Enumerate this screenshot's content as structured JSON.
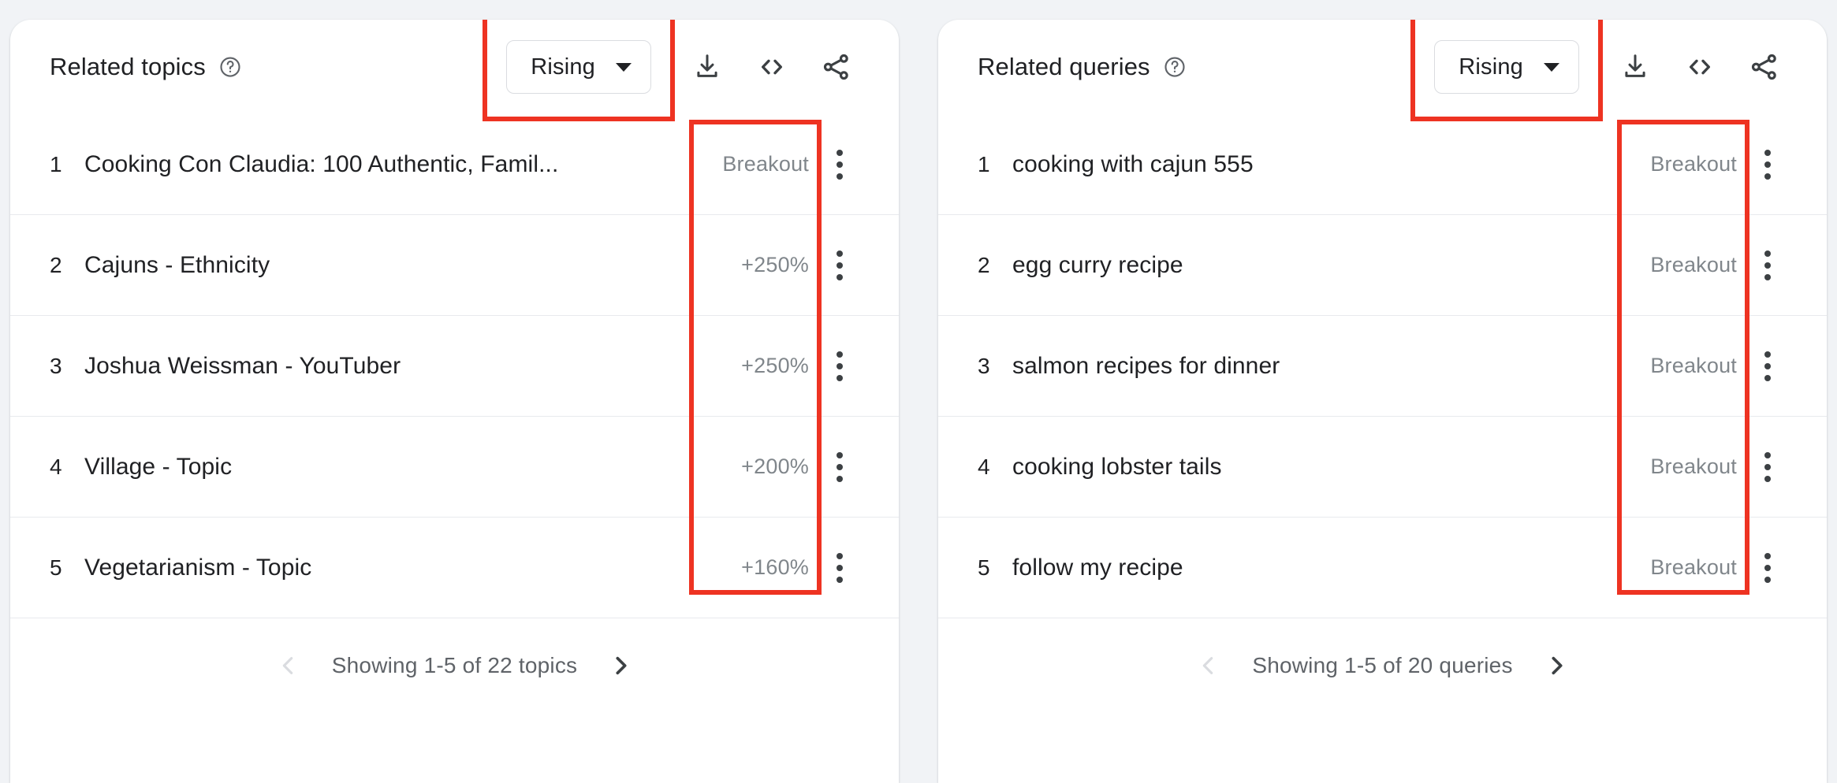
{
  "colors": {
    "page_background": "#f1f3f6",
    "card_background": "#ffffff",
    "highlight_red": "#ee3322",
    "primary_text": "#202124",
    "muted_text": "#5f6368",
    "value_text": "#80868b",
    "divider": "#e8eaed",
    "arrow_disabled": "#dadce0"
  },
  "panels": [
    {
      "title": "Related topics",
      "help_icon": "help-circle-icon",
      "sort_select": {
        "value": "Rising",
        "caret_icon": "chevron-down-icon",
        "highlighted": true
      },
      "actions": [
        {
          "icon": "download-icon",
          "label": "Download"
        },
        {
          "icon": "embed-code-icon",
          "label": "Embed"
        },
        {
          "icon": "share-icon",
          "label": "Share"
        }
      ],
      "value_column_highlighted": true,
      "rows": [
        {
          "rank": "1",
          "label": "Cooking Con Claudia: 100 Authentic, Famil...",
          "value": "Breakout",
          "menu_icon": "more-vert-icon"
        },
        {
          "rank": "2",
          "label": "Cajuns - Ethnicity",
          "value": "+250%",
          "menu_icon": "more-vert-icon"
        },
        {
          "rank": "3",
          "label": "Joshua Weissman - YouTuber",
          "value": "+250%",
          "menu_icon": "more-vert-icon"
        },
        {
          "rank": "4",
          "label": "Village - Topic",
          "value": "+200%",
          "menu_icon": "more-vert-icon"
        },
        {
          "rank": "5",
          "label": "Vegetarianism - Topic",
          "value": "+160%",
          "menu_icon": "more-vert-icon"
        }
      ],
      "footer": {
        "prev_icon": "chevron-left-icon",
        "prev_enabled": false,
        "text": "Showing 1-5 of 22 topics",
        "next_icon": "chevron-right-icon",
        "next_enabled": true
      }
    },
    {
      "title": "Related queries",
      "help_icon": "help-circle-icon",
      "sort_select": {
        "value": "Rising",
        "caret_icon": "chevron-down-icon",
        "highlighted": true
      },
      "actions": [
        {
          "icon": "download-icon",
          "label": "Download"
        },
        {
          "icon": "embed-code-icon",
          "label": "Embed"
        },
        {
          "icon": "share-icon",
          "label": "Share"
        }
      ],
      "value_column_highlighted": true,
      "rows": [
        {
          "rank": "1",
          "label": "cooking with cajun 555",
          "value": "Breakout",
          "menu_icon": "more-vert-icon"
        },
        {
          "rank": "2",
          "label": "egg curry recipe",
          "value": "Breakout",
          "menu_icon": "more-vert-icon"
        },
        {
          "rank": "3",
          "label": "salmon recipes for dinner",
          "value": "Breakout",
          "menu_icon": "more-vert-icon"
        },
        {
          "rank": "4",
          "label": "cooking lobster tails",
          "value": "Breakout",
          "menu_icon": "more-vert-icon"
        },
        {
          "rank": "5",
          "label": "follow my recipe",
          "value": "Breakout",
          "menu_icon": "more-vert-icon"
        }
      ],
      "footer": {
        "prev_icon": "chevron-left-icon",
        "prev_enabled": false,
        "text": "Showing 1-5 of 20 queries",
        "next_icon": "chevron-right-icon",
        "next_enabled": true
      }
    }
  ]
}
